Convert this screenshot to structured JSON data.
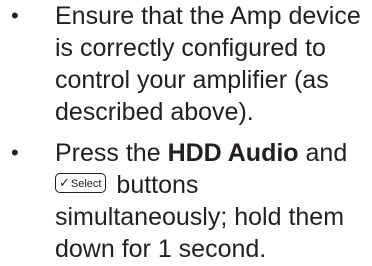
{
  "items": [
    {
      "bullet": "•",
      "lines": [
        "Ensure that the Amp device",
        "is correctly configured to",
        "control your amplifier (as",
        "described above)."
      ]
    },
    {
      "bullet": "•",
      "line1_pre": "Press the ",
      "line1_bold": "HDD Audio",
      "line1_post": " and",
      "select_key_check": "✓",
      "select_key_label": "Select",
      "line2_post": " buttons",
      "line3": "simultaneously; hold them",
      "line4": "down for 1 second."
    }
  ]
}
